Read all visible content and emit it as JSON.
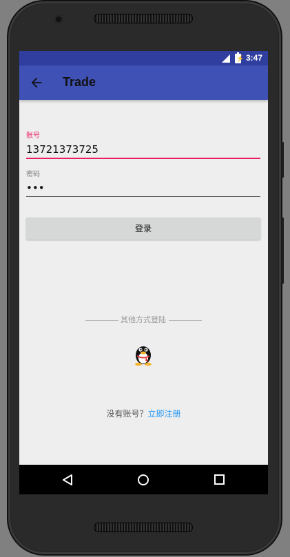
{
  "status_bar": {
    "time": "3:47",
    "signal_icon": "cellular-signal-icon",
    "battery_icon": "battery-charging-icon"
  },
  "app_bar": {
    "title": "Trade",
    "back_icon": "arrow-back-icon",
    "color": "#3f51b5",
    "status_color": "#303f9f"
  },
  "form": {
    "account": {
      "label": "账号",
      "value": "13721373725",
      "accent": "#e91e63"
    },
    "password": {
      "label": "密码",
      "value": "•••"
    },
    "login_label": "登录"
  },
  "other_login": {
    "label": "其他方式登陆",
    "qq_icon": "qq-penguin-icon"
  },
  "register": {
    "prompt": "没有账号？",
    "link": "立即注册",
    "link_color": "#2196f3"
  },
  "nav_bar": {
    "back": "nav-back-icon",
    "home": "nav-home-icon",
    "recents": "nav-recents-icon"
  }
}
